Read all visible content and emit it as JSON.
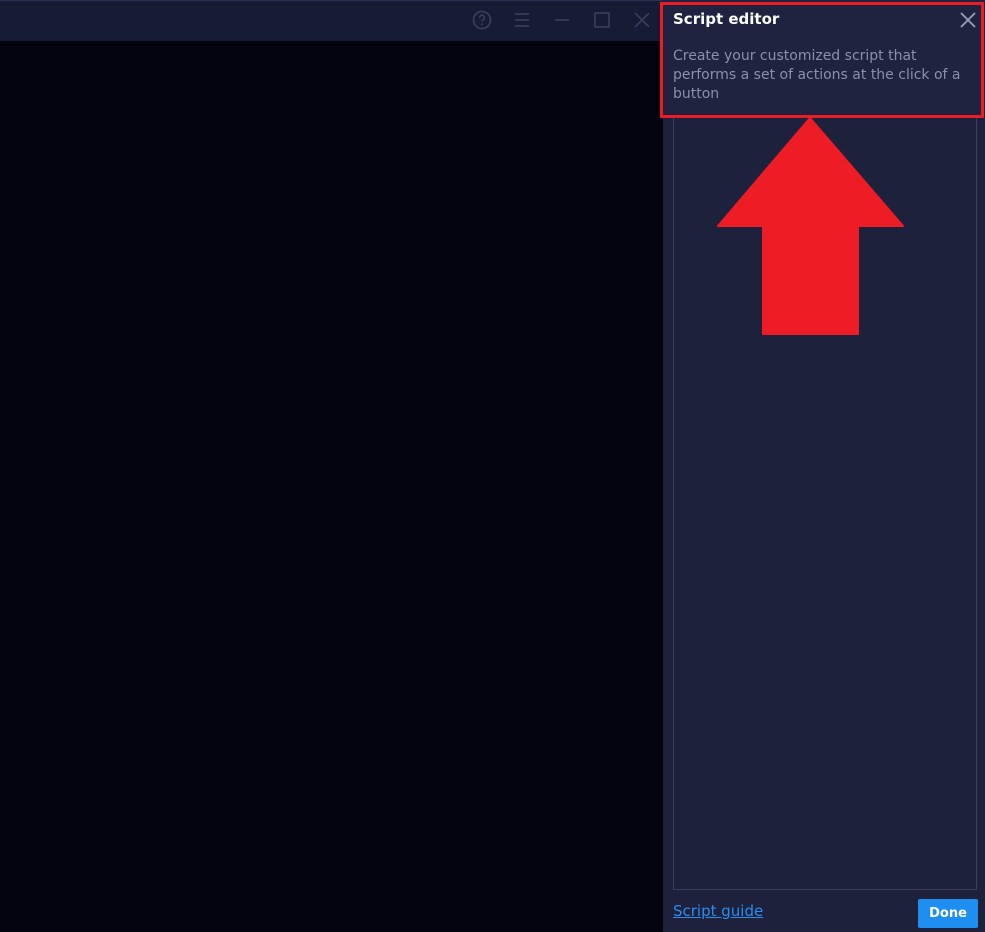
{
  "titlebar": {
    "icons": [
      "help-icon",
      "menu-icon",
      "minimize-icon",
      "maximize-icon",
      "close-icon"
    ]
  },
  "panel": {
    "title": "Script editor",
    "description": "Create your customized script that performs a set of actions at the click of a button",
    "close_icon": "close-icon",
    "script_guide_label": "Script guide",
    "done_label": "Done"
  },
  "annotation": {
    "highlight_color": "#ea1c24",
    "arrow_direction": "up"
  },
  "colors": {
    "background": "#03040f",
    "titlebar": "#171b33",
    "panel": "#1d213b",
    "accent": "#1e8ff0",
    "link": "#2b8df0"
  }
}
